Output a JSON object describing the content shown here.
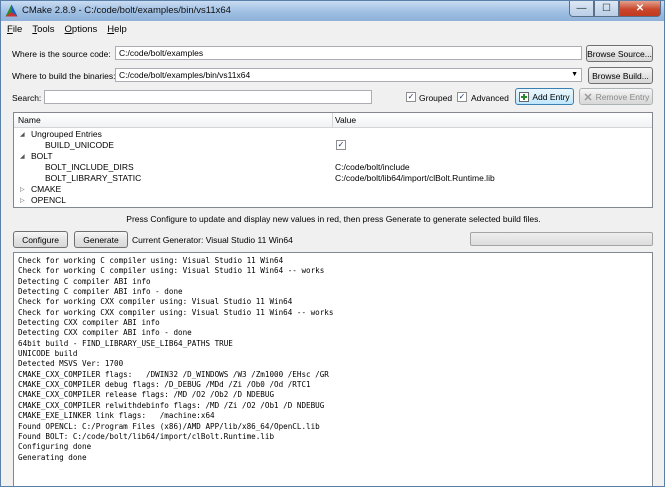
{
  "window": {
    "title": "CMake 2.8.9 - C:/code/bolt/examples/bin/vs11x64"
  },
  "titlebar": {
    "minimize_glyph": "—",
    "maximize_glyph": "☐",
    "close_glyph": "✕"
  },
  "menu": [
    {
      "label": "File",
      "accel": "F",
      "rest": "ile"
    },
    {
      "label": "Tools",
      "accel": "T",
      "rest": "ools"
    },
    {
      "label": "Options",
      "accel": "O",
      "rest": "ptions"
    },
    {
      "label": "Help",
      "accel": "H",
      "rest": "elp"
    }
  ],
  "source": {
    "label": "Where is the source code:",
    "value": "C:/code/bolt/examples",
    "browse_label": "Browse Source..."
  },
  "build": {
    "label": "Where to build the binaries:",
    "value": "C:/code/bolt/examples/bin/vs11x64",
    "browse_label": "Browse Build..."
  },
  "search": {
    "label": "Search:",
    "value": ""
  },
  "options": {
    "grouped_label": "Grouped",
    "grouped_checked": true,
    "advanced_label": "Advanced",
    "advanced_checked": true
  },
  "entries": {
    "add_label": "Add Entry",
    "remove_label": "Remove Entry"
  },
  "tree": {
    "col_name": "Name",
    "col_value": "Value",
    "rows": [
      {
        "name": "Ungrouped Entries",
        "value": "",
        "expanded": true,
        "level": 0
      },
      {
        "name": "BUILD_UNICODE",
        "value": "✓",
        "level": 1
      },
      {
        "name": "BOLT",
        "value": "",
        "expanded": true,
        "level": 0
      },
      {
        "name": "BOLT_INCLUDE_DIRS",
        "value": "C:/code/bolt/include",
        "level": 1
      },
      {
        "name": "BOLT_LIBRARY_STATIC",
        "value": "C:/code/bolt/lib64/import/clBolt.Runtime.lib",
        "level": 1
      },
      {
        "name": "CMAKE",
        "value": "",
        "expanded": false,
        "level": 0
      },
      {
        "name": "OPENCL",
        "value": "",
        "expanded": false,
        "level": 0
      }
    ]
  },
  "hint": "Press Configure to update and display new values in red, then press Generate to generate selected build files.",
  "actions": {
    "configure_label": "Configure",
    "generate_label": "Generate",
    "generator_text": "Current Generator: Visual Studio 11 Win64",
    "progress": 0
  },
  "output": [
    "Check for working C compiler using: Visual Studio 11 Win64",
    "Check for working C compiler using: Visual Studio 11 Win64 -- works",
    "Detecting C compiler ABI info",
    "Detecting C compiler ABI info - done",
    "Check for working CXX compiler using: Visual Studio 11 Win64",
    "Check for working CXX compiler using: Visual Studio 11 Win64 -- works",
    "Detecting CXX compiler ABI info",
    "Detecting CXX compiler ABI info - done",
    "64bit build - FIND_LIBRARY_USE_LIB64_PATHS TRUE",
    "UNICODE build",
    "Detected MSVS Ver: 1700",
    "CMAKE_CXX_COMPILER flags:   /DWIN32 /D_WINDOWS /W3 /Zm1000 /EHsc /GR",
    "CMAKE_CXX_COMPILER debug flags: /D_DEBUG /MDd /Zi /Ob0 /Od /RTC1",
    "CMAKE_CXX_COMPILER release flags: /MD /O2 /Ob2 /D NDEBUG",
    "CMAKE_CXX_COMPILER relwithdebinfo flags: /MD /Zi /O2 /Ob1 /D NDEBUG",
    "CMAKE_EXE_LINKER link flags:   /machine:x64",
    "Found OPENCL: C:/Program Files (x86)/AMD APP/lib/x86_64/OpenCL.lib",
    "Found BOLT: C:/code/bolt/lib64/import/clBolt.Runtime.lib",
    "Configuring done",
    "Generating done"
  ],
  "icons": {
    "app": "cmake-triangle-icon",
    "add": "add-entry-icon",
    "remove": "remove-entry-icon",
    "dropdown": "dropdown-arrow-icon"
  },
  "colors": {
    "titlebar": "#9fbfe3",
    "close": "#c9472d",
    "text": "#000000"
  }
}
